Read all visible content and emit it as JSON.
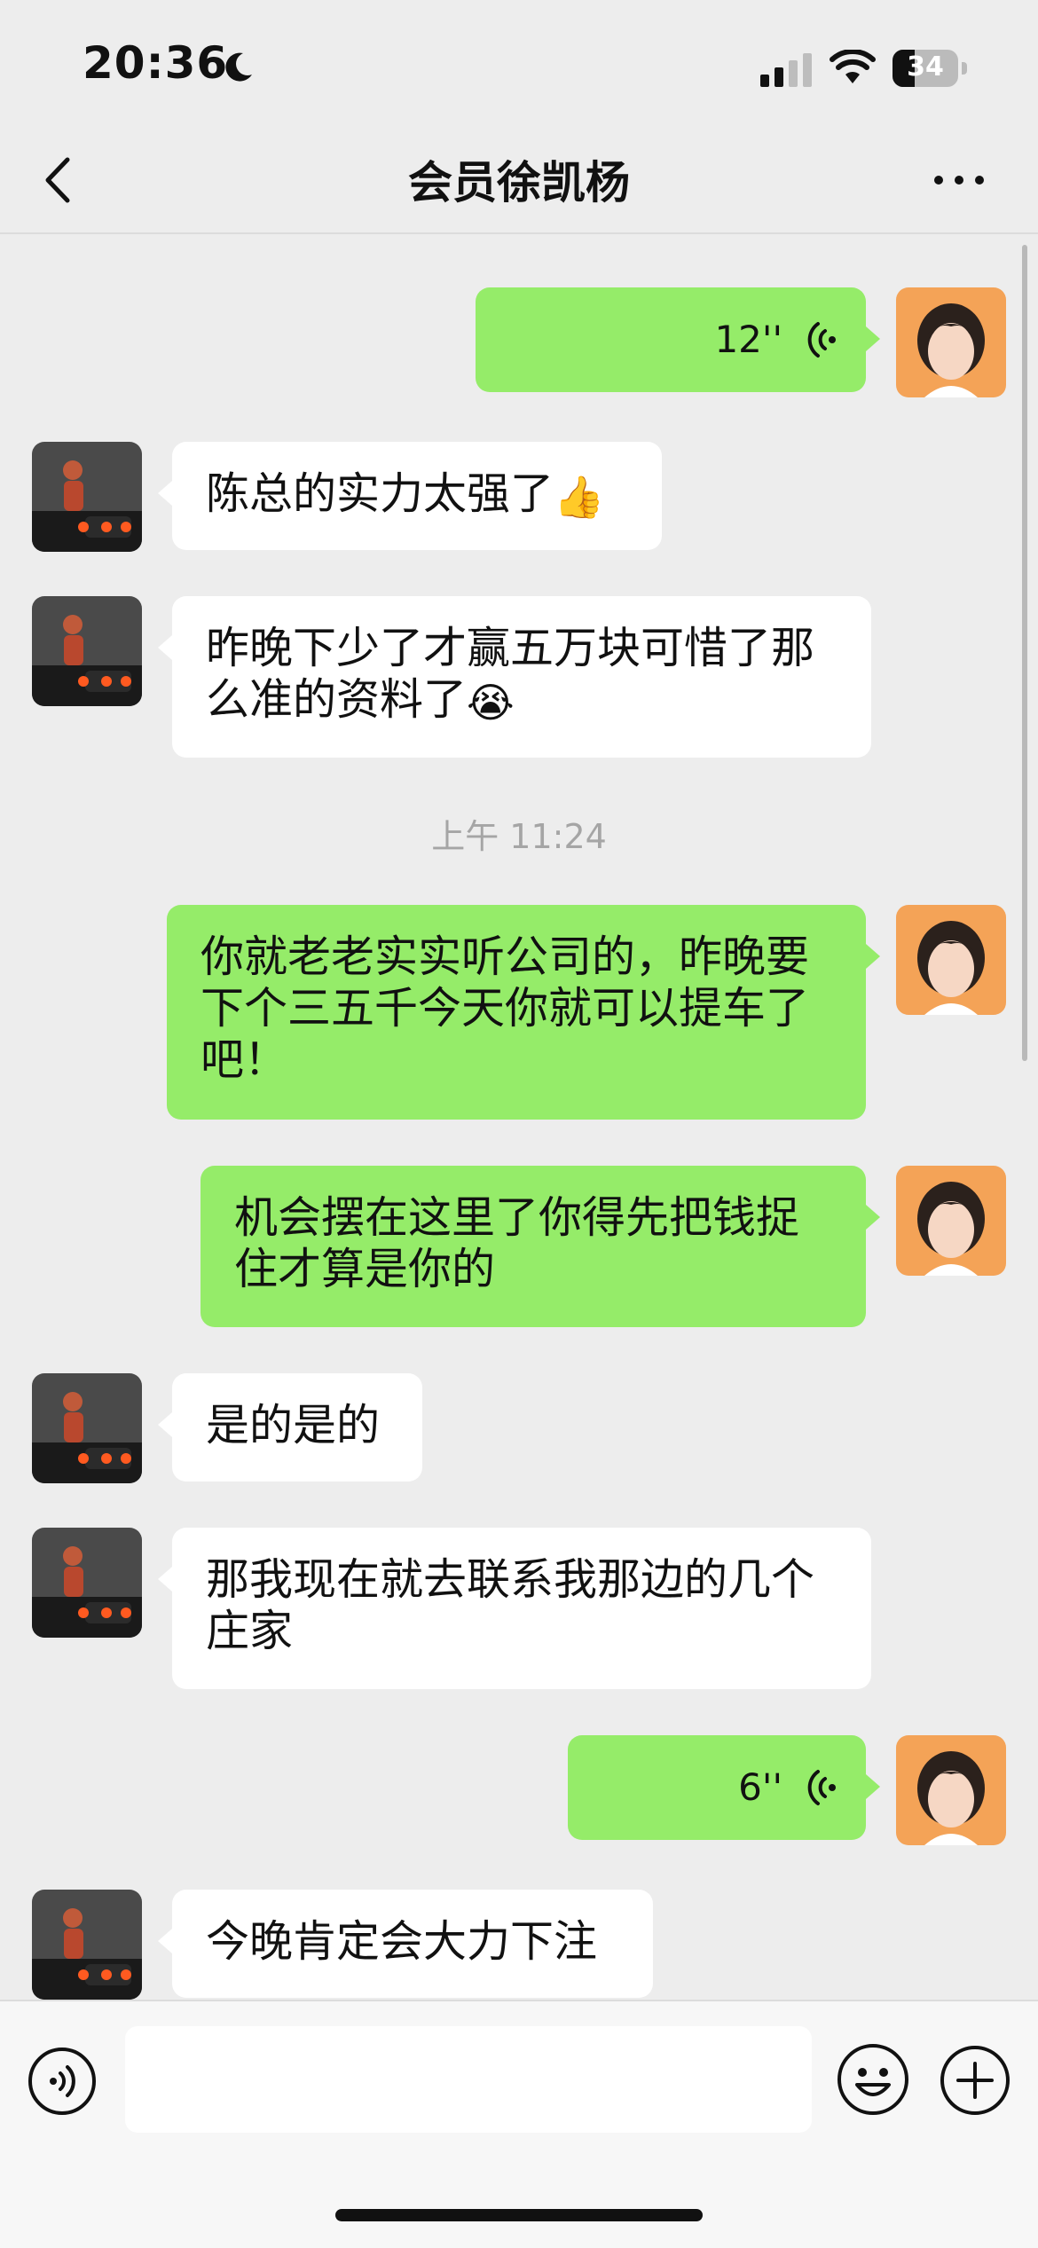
{
  "status_bar": {
    "time": "20:36",
    "battery": "34",
    "battery_fraction": 0.34,
    "icons": [
      "moon-icon",
      "cellular-signal-icon",
      "wifi-icon",
      "battery-icon"
    ]
  },
  "nav": {
    "title": "会员徐凯杨",
    "back_icon": "chevron-left-icon",
    "more_icon": "more-dots-icon"
  },
  "timestamp": "上午 11:24",
  "messages": [
    {
      "side": "out",
      "type": "voice",
      "duration": "12''"
    },
    {
      "side": "in",
      "type": "text",
      "text": "陈总的实力太强了",
      "emoji": "👍"
    },
    {
      "side": "in",
      "type": "text",
      "text": "昨晚下少了才赢五万块可惜了那么准的资料了",
      "emoji": "😭"
    },
    {
      "side": "out",
      "type": "text",
      "text": "你就老老实实听公司的，昨晚要下个三五千今天你就可以提车了吧！"
    },
    {
      "side": "out",
      "type": "text",
      "text": "机会摆在这里了你得先把钱捉住才算是你的"
    },
    {
      "side": "in",
      "type": "text",
      "text": "是的是的"
    },
    {
      "side": "in",
      "type": "text",
      "text": "那我现在就去联系我那边的几个庄家"
    },
    {
      "side": "out",
      "type": "voice",
      "duration": "6''"
    },
    {
      "side": "in",
      "type": "text",
      "text": "今晚肯定会大力下注"
    }
  ],
  "input_bar": {
    "placeholder": "",
    "icons": [
      "voice-mode-icon",
      "emoji-icon",
      "plus-icon"
    ]
  },
  "colors": {
    "background": "#ededed",
    "outgoing_bubble": "#95ec69",
    "incoming_bubble": "#ffffff"
  }
}
